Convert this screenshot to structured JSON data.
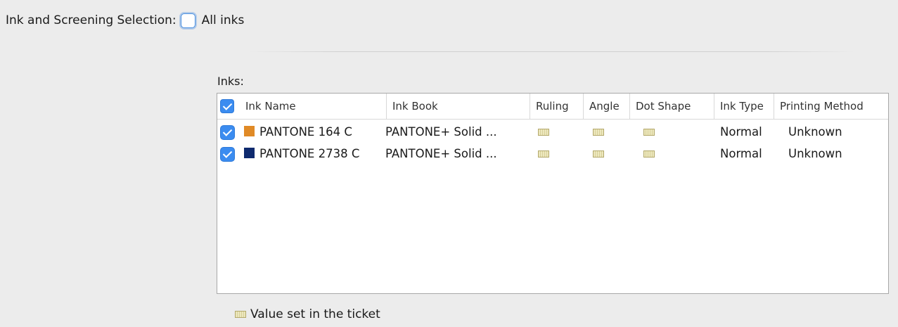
{
  "selection": {
    "label": "Ink and Screening Selection:",
    "all_inks_label": "All inks",
    "all_inks_checked": false
  },
  "inks_label": "Inks:",
  "table": {
    "columns": [
      "Ink Name",
      "Ink Book",
      "Ruling",
      "Angle",
      "Dot Shape",
      "Ink Type",
      "Printing Method"
    ],
    "header_checkbox_checked": true,
    "rows": [
      {
        "checked": true,
        "swatch_color": "#e08a26",
        "ink_name": "PANTONE 164 C",
        "ink_book": "PANTONE+ Solid ...",
        "ruling_icon": "ticket-value-icon",
        "angle_icon": "ticket-value-icon",
        "dot_shape_icon": "ticket-value-icon",
        "ink_type": "Normal",
        "printing_method": "Unknown"
      },
      {
        "checked": true,
        "swatch_color": "#0e2a6e",
        "ink_name": "PANTONE 2738 C",
        "ink_book": "PANTONE+ Solid ...",
        "ruling_icon": "ticket-value-icon",
        "angle_icon": "ticket-value-icon",
        "dot_shape_icon": "ticket-value-icon",
        "ink_type": "Normal",
        "printing_method": "Unknown"
      }
    ]
  },
  "legend": {
    "icon": "ticket-value-icon",
    "text": "Value set in the ticket"
  },
  "colors": {
    "accent": "#3b8cf0",
    "background": "#ececec"
  }
}
